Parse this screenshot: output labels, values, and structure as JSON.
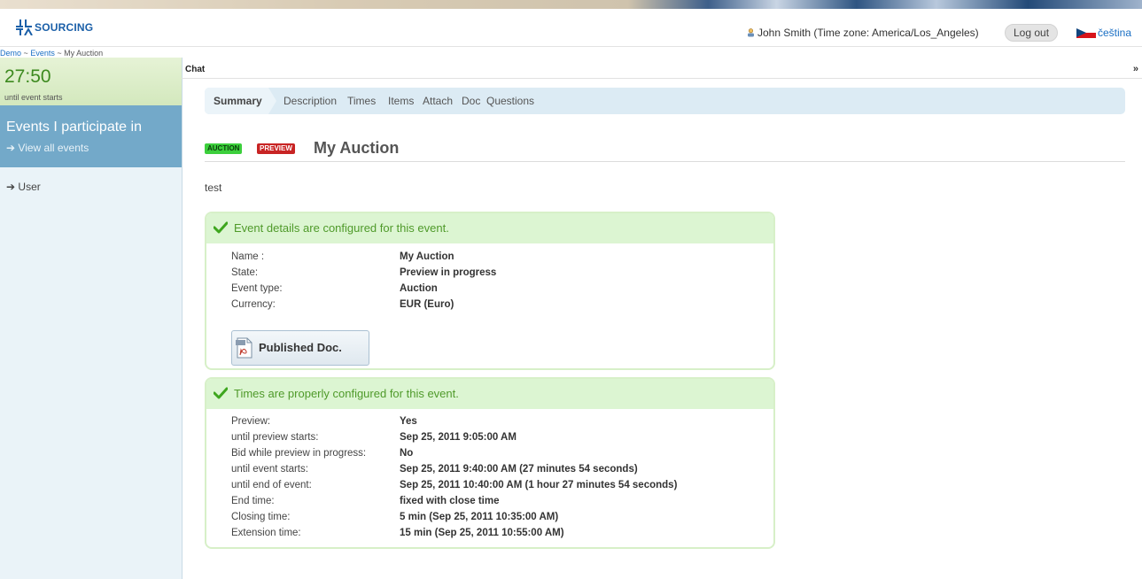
{
  "header": {
    "logo_text": "SOURCING",
    "user_label": "John Smith (Time zone: America/Los_Angeles)",
    "logout_label": "Log out",
    "language_label": "čeština"
  },
  "breadcrumb": {
    "items": [
      "Demo",
      "Events",
      "My Auction"
    ],
    "separator": "~"
  },
  "sidebar": {
    "timer_value": "27:50",
    "timer_label": "until event starts",
    "events_title": "Events I participate in",
    "view_all_label": "View all events",
    "user_label": "User"
  },
  "chat": {
    "label": "Chat",
    "toggle": "»"
  },
  "tabs": [
    {
      "label": "Summary",
      "active": true
    },
    {
      "label": "Description"
    },
    {
      "label": "Times"
    },
    {
      "label": "Items"
    },
    {
      "label": "Attach"
    },
    {
      "label": "Doc"
    },
    {
      "label": "Questions"
    }
  ],
  "event": {
    "badge_type": "AUCTION",
    "badge_state": "PREVIEW",
    "title": "My Auction",
    "description": "test"
  },
  "details_panel": {
    "title": "Event details are configured for this event.",
    "rows": [
      {
        "label": "Name :",
        "value": "My Auction"
      },
      {
        "label": "State:",
        "value": "Preview in progress"
      },
      {
        "label": "Event type:",
        "value": "Auction"
      },
      {
        "label": "Currency:",
        "value": "EUR (Euro)"
      }
    ],
    "doc_button_label": "Published Doc."
  },
  "times_panel": {
    "title": "Times are properly configured for this event.",
    "rows": [
      {
        "label": "Preview:",
        "value": "Yes"
      },
      {
        "label": "until preview starts:",
        "value": "Sep 25, 2011 9:05:00 AM"
      },
      {
        "label": "Bid while preview in progress:",
        "value": "No"
      },
      {
        "label": "until event starts:",
        "value": "Sep 25, 2011 9:40:00 AM (27 minutes 54 seconds)"
      },
      {
        "label": "until end of event:",
        "value": "Sep 25, 2011 10:40:00 AM (1 hour 27 minutes 54 seconds)"
      },
      {
        "label": "End time:",
        "value": "fixed with close time"
      },
      {
        "label": "Closing time:",
        "value": "5 min (Sep 25, 2011 10:35:00 AM)"
      },
      {
        "label": "Extension time:",
        "value": "15 min (Sep 25, 2011 10:55:00 AM)"
      }
    ]
  },
  "colors": {
    "accent": "#1a6fc4",
    "sidebar_highlight": "#73a9c9",
    "timer_green": "#3d8a1f",
    "success_green": "#4f9a2a",
    "preview_red": "#c82424"
  }
}
